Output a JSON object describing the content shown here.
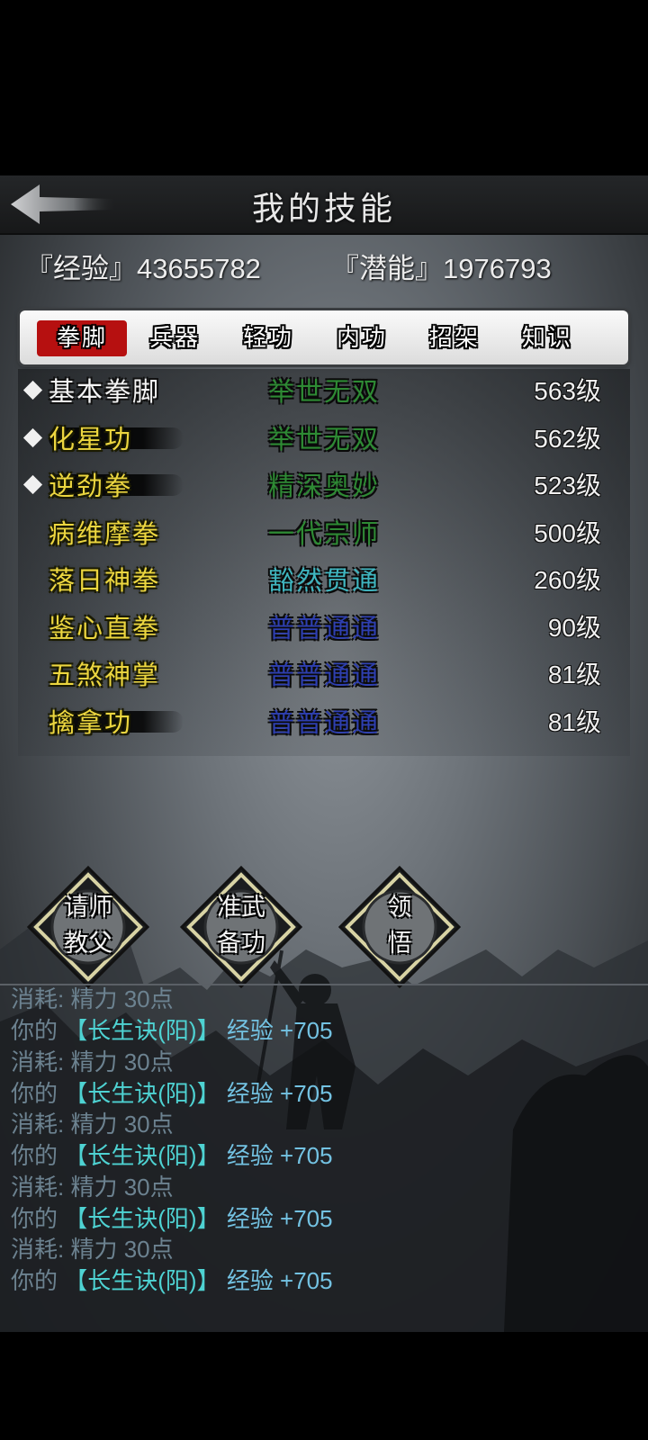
{
  "header": {
    "title": "我的技能"
  },
  "stats": {
    "experience": "『经验』43655782",
    "potential": "『潜能』1976793"
  },
  "tabs": [
    {
      "label": "拳脚",
      "active": true
    },
    {
      "label": "兵器",
      "active": false
    },
    {
      "label": "轻功",
      "active": false
    },
    {
      "label": "内功",
      "active": false
    },
    {
      "label": "招架",
      "active": false
    },
    {
      "label": "知识",
      "active": false
    }
  ],
  "skills": [
    {
      "name": "基本拳脚",
      "rank": "举世无双",
      "level": "563级",
      "marked": true,
      "name_color": "white",
      "rank_color": "#2e8a34"
    },
    {
      "name": "化星功",
      "rank": "举世无双",
      "level": "562级",
      "marked": true,
      "name_color": "yellow",
      "rank_color": "#2e8a34"
    },
    {
      "name": "逆劲拳",
      "rank": "精深奥妙",
      "level": "523级",
      "marked": true,
      "name_color": "yellow",
      "rank_color": "#2e8a34"
    },
    {
      "name": "病维摩拳",
      "rank": "一代宗师",
      "level": "500级",
      "marked": false,
      "name_color": "yellow",
      "rank_color": "#2e8a34"
    },
    {
      "name": "落日神拳",
      "rank": "豁然贯通",
      "level": "260级",
      "marked": false,
      "name_color": "yellow",
      "rank_color": "#3fb6c0"
    },
    {
      "name": "鉴心直拳",
      "rank": "普普通通",
      "level": "90级",
      "marked": false,
      "name_color": "yellow",
      "rank_color": "#2e3fb0"
    },
    {
      "name": "五煞神掌",
      "rank": "普普通通",
      "level": "81级",
      "marked": false,
      "name_color": "yellow",
      "rank_color": "#2e3fb0"
    },
    {
      "name": "擒拿功",
      "rank": "普普通通",
      "level": "81级",
      "marked": false,
      "name_color": "yellow",
      "rank_color": "#2e3fb0"
    }
  ],
  "actions": [
    {
      "line1": "请师",
      "line2": "教父"
    },
    {
      "line1": "准武",
      "line2": "备功"
    },
    {
      "line1": "领",
      "line2": "悟"
    }
  ],
  "log": {
    "cost_prefix": "消耗:",
    "cost_value": "精力 30点",
    "gain_prefix": "你的",
    "gain_skill": "【长生诀(阳)】",
    "gain_value": "经验 +705",
    "repeat": 5
  },
  "colors": {
    "active_tab": "#b61010",
    "skill_yellow": "#ecd640",
    "log_gray": "#6c8290",
    "log_cyan": "#4ed2d2"
  }
}
